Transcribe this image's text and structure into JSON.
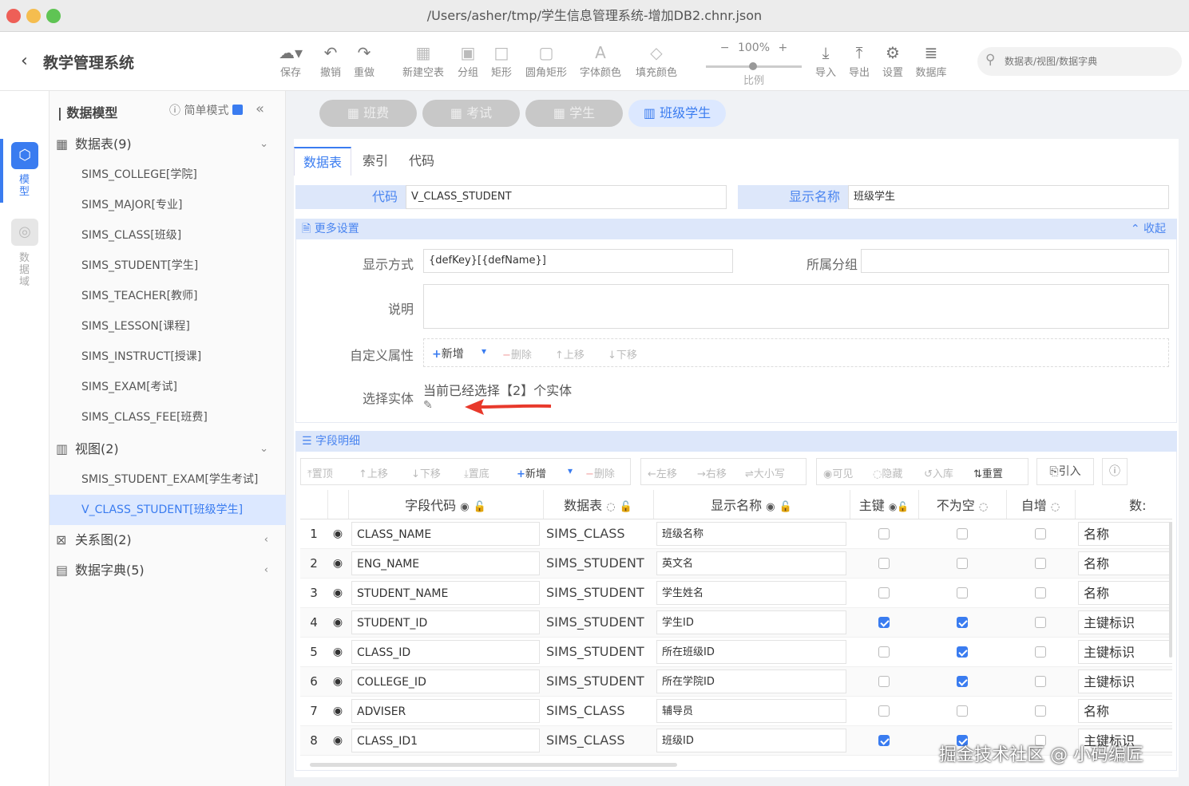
{
  "window": {
    "title": "/Users/asher/tmp/学生信息管理系统-增加DB2.chnr.json"
  },
  "app": {
    "back": "‹",
    "name": "教学管理系统"
  },
  "toolbar": {
    "save": "保存",
    "undo": "撤销",
    "redo": "重做",
    "new_table": "新建空表",
    "group": "分组",
    "rect": "矩形",
    "round_rect": "圆角矩形",
    "font_color": "字体颜色",
    "fill_color": "填充颜色",
    "zoom": "100%",
    "zoom_label": "比例",
    "import": "导入",
    "export": "导出",
    "settings": "设置",
    "database": "数据库",
    "search_placeholder": "数据表/视图/数据字典"
  },
  "leftbar": {
    "model": "模型",
    "domain": "数据域"
  },
  "sidebar": {
    "title": "数据模型",
    "simple_mode": "简单模式",
    "tables_group": "数据表(9)",
    "tables": [
      "SIMS_COLLEGE[学院]",
      "SIMS_MAJOR[专业]",
      "SIMS_CLASS[班级]",
      "SIMS_STUDENT[学生]",
      "SIMS_TEACHER[教师]",
      "SIMS_LESSON[课程]",
      "SIMS_INSTRUCT[授课]",
      "SIMS_EXAM[考试]",
      "SIMS_CLASS_FEE[班费]"
    ],
    "views_group": "视图(2)",
    "views": [
      "SMIS_STUDENT_EXAM[学生考试]",
      "V_CLASS_STUDENT[班级学生]"
    ],
    "relations_group": "关系图(2)",
    "dict_group": "数据字典(5)"
  },
  "tabs": [
    "班费",
    "考试",
    "学生",
    "班级学生"
  ],
  "subtabs": [
    "数据表",
    "索引",
    "代码"
  ],
  "form": {
    "code_label": "代码",
    "code_value": "V_CLASS_STUDENT",
    "display_label": "显示名称",
    "display_value": "班级学生",
    "more_settings": "更多设置",
    "collapse": "收起",
    "display_mode_label": "显示方式",
    "display_mode_value": "{defKey}[{defName}]",
    "group_label": "所属分组",
    "desc_label": "说明",
    "custom_attr_label": "自定义属性",
    "custom_add": "新增",
    "custom_del": "删除",
    "custom_up": "上移",
    "custom_down": "下移",
    "select_entity_label": "选择实体",
    "select_entity_value": "当前已经选择【2】个实体"
  },
  "fields": {
    "section": "字段明细",
    "toolbar": [
      "置顶",
      "上移",
      "下移",
      "置底",
      "新增",
      "删除",
      "左移",
      "右移",
      "大小写",
      "可见",
      "隐藏",
      "入库",
      "重置",
      "引入"
    ],
    "columns": [
      "字段代码",
      "数据表",
      "显示名称",
      "主键",
      "不为空",
      "自增",
      "数:"
    ],
    "rows": [
      {
        "n": "1",
        "code": "CLASS_NAME",
        "table": "SIMS_CLASS",
        "name": "班级名称",
        "pk": false,
        "nn": false,
        "ai": false,
        "type": "名称"
      },
      {
        "n": "2",
        "code": "ENG_NAME",
        "table": "SIMS_STUDENT",
        "name": "英文名",
        "pk": false,
        "nn": false,
        "ai": false,
        "type": "名称"
      },
      {
        "n": "3",
        "code": "STUDENT_NAME",
        "table": "SIMS_STUDENT",
        "name": "学生姓名",
        "pk": false,
        "nn": false,
        "ai": false,
        "type": "名称"
      },
      {
        "n": "4",
        "code": "STUDENT_ID",
        "table": "SIMS_STUDENT",
        "name": "学生ID",
        "pk": true,
        "nn": true,
        "ai": false,
        "type": "主键标识"
      },
      {
        "n": "5",
        "code": "CLASS_ID",
        "table": "SIMS_STUDENT",
        "name": "所在班级ID",
        "pk": false,
        "nn": true,
        "ai": false,
        "type": "主键标识"
      },
      {
        "n": "6",
        "code": "COLLEGE_ID",
        "table": "SIMS_STUDENT",
        "name": "所在学院ID",
        "pk": false,
        "nn": true,
        "ai": false,
        "type": "主键标识"
      },
      {
        "n": "7",
        "code": "ADVISER",
        "table": "SIMS_CLASS",
        "name": "辅导员",
        "pk": false,
        "nn": false,
        "ai": false,
        "type": "名称"
      },
      {
        "n": "8",
        "code": "CLASS_ID1",
        "table": "SIMS_CLASS",
        "name": "班级ID",
        "pk": true,
        "nn": true,
        "ai": false,
        "type": "主键标识"
      }
    ]
  },
  "watermark": "掘金技术社区 @ 小码编匠"
}
